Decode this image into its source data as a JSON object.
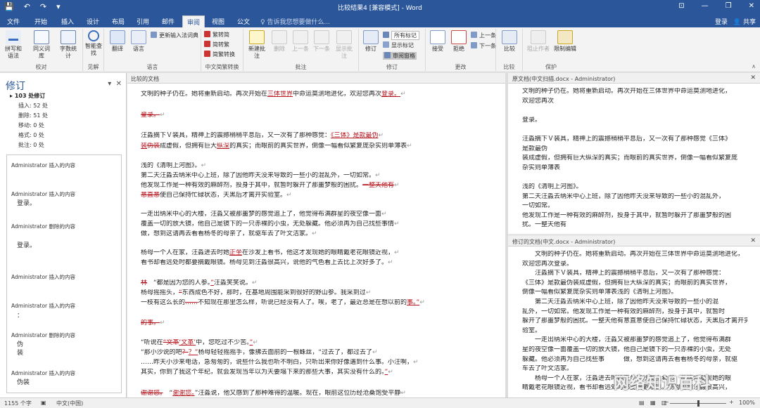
{
  "window": {
    "title": "比较结果4 [兼容模式] - Word",
    "quick_access": [
      "💾",
      "↶",
      "↷",
      "▾"
    ],
    "controls": [
      "⊡",
      "—",
      "❐",
      "✕"
    ]
  },
  "tabs": [
    "文件",
    "开始",
    "插入",
    "设计",
    "布局",
    "引用",
    "邮件",
    "审阅",
    "视图",
    "公文"
  ],
  "tell_me": "♀ 告诉我您想要做什么...",
  "login": "登录",
  "share": "共享",
  "ribbon": {
    "proof": {
      "label": "校对",
      "buttons": [
        "拼写和语法",
        "同义词库",
        "字数统计"
      ]
    },
    "insights": {
      "label": "见解",
      "buttons": [
        "智能查找"
      ]
    },
    "language": {
      "label": "语言",
      "buttons": [
        "翻译",
        "语言"
      ],
      "extra": "更新输入法词典"
    },
    "chinese": {
      "label": "中文简繁转换",
      "items": [
        "繁转简",
        "简转繁",
        "简繁转换"
      ]
    },
    "comments": {
      "label": "批注",
      "buttons": [
        "新建批注",
        "删除",
        "上一条",
        "下一条",
        "显示批注"
      ]
    },
    "tracking": {
      "label": "修订",
      "buttons": [
        "修订"
      ],
      "markup": "所有标记",
      "show_markup": "显示标记",
      "pane": "审阅窗格"
    },
    "changes": {
      "label": "更改",
      "buttons": [
        "接受",
        "拒绝"
      ],
      "prev": "上一条",
      "next": "下一条"
    },
    "compare": {
      "label": "比较",
      "buttons": [
        "比较"
      ]
    },
    "protect": {
      "label": "保护",
      "buttons": [
        "阻止作者",
        "限制编辑"
      ]
    }
  },
  "revisions_pane": {
    "title": "修订",
    "count": "103 处修订",
    "stats": [
      "插入: 52 处",
      "删除: 51 处",
      "移动: 0 处",
      "格式: 0 处",
      "批注: 0 处"
    ],
    "entries": [
      {
        "author": "Administrator",
        "action": "插入的内容",
        "text": ""
      },
      {
        "author": "Administrator",
        "action": "插入的内容",
        "text": "登录。"
      },
      {
        "author": "Administrator",
        "action": "删除的内容",
        "text": "登录。"
      },
      {
        "author": "Administrator",
        "action": "插入的内容",
        "text": ""
      },
      {
        "author": "Administrator",
        "action": "插入的内容",
        "text": "："
      },
      {
        "author": "Administrator",
        "action": "删除的内容",
        "text": "伪"
      },
      {
        "author": "",
        "action": "",
        "text": "装"
      },
      {
        "author": "Administrator",
        "action": "插入的内容",
        "text": "伪装"
      }
    ]
  },
  "compared_doc": {
    "header": "比较的文档",
    "lines": [
      [
        [
          "n",
          "文明的种子仍在。她将重新启动。再次开始在"
        ],
        [
          "i",
          "三体世界"
        ],
        [
          "n",
          "中命运莫测地进化，欢迎您再次"
        ],
        [
          "i",
          "登录。"
        ]
      ],
      [
        [
          "d",
          "登录。"
        ]
      ],
      [
        [
          "n",
          "汪淼摘下Ｖ装具，精神上的震撼稍稍平息后，又一次有了那种感觉："
        ],
        [
          "i",
          "《三体》是款最伪"
        ]
      ],
      [
        [
          "i",
          "装"
        ],
        [
          "d",
          "伪装"
        ],
        [
          "n",
          "成虚假，但拥有巨大"
        ],
        [
          "i",
          "纵深"
        ],
        [
          "n",
          "的真实"
        ],
        [
          "n",
          "；而眼前的真实世界，倒像一幅看似繁复庞杂实则单薄表"
        ]
      ],
      [
        [
          "n",
          "浅的《清明上河图》。"
        ]
      ],
      [
        [
          "n",
          "第二天汪淼去纳米中心上班，除了因他昨天没来导致的一些小的混乱外，一切如常。"
        ]
      ],
      [
        [
          "n",
          "他发现工作是一种有效的麻醉剂，投身于其中，就暂时躲开了那噩梦般的困扰。"
        ],
        [
          "d",
          "一整天他有"
        ]
      ],
      [
        [
          "d",
          "意直意"
        ],
        [
          "n",
          "使自己保持忙碌状态，天黑后才离开实验室。"
        ]
      ],
      [
        [
          "n",
          "一走出纳米中心的大楼，汪淼又被那噩梦的感觉追上了，他觉得布满群星的夜空像一面"
        ]
      ],
      [
        [
          "n",
          "覆盖一切的放大镜，他自己是镜下的一只赤裸的小虫，无处躲藏。他必须再为自己找些事情"
        ]
      ],
      [
        [
          "n",
          "做，想到这请再去看看杨冬的母亲了，就驱车去了叶文洁家。"
        ]
      ],
      [
        [
          "n",
          "杨母一个人在家，汪淼进去时她"
        ],
        [
          "i",
          "正坐"
        ],
        [
          "n",
          "在沙发上看书，他这才发现她的眼睛戴老花眼镜近视，"
        ]
      ],
      [
        [
          "n",
          "看书却看远处时都要摘戴眼镜。杨母见到汪淼很高兴，说他的气色看上去比上次好多了。"
        ]
      ],
      [
        [
          "d",
          "林"
        ],
        [
          "n",
          "　“都是因为您的人参。"
        ],
        [
          "i",
          "”"
        ],
        [
          "n",
          "汪淼笑笑说。"
        ]
      ],
      [
        [
          "n",
          "杨母摇摇头，"
        ],
        [
          "d",
          "“"
        ],
        [
          "n",
          "东西成色不好，那时，在基地周围能采到很好的野山参。我采到过"
        ]
      ],
      [
        [
          "n",
          "一枝有这么长的"
        ],
        [
          "d",
          "……"
        ],
        [
          "n",
          "不知现在那里怎么样，听说已经没有人了。唉，老了，最近总是在想以前的"
        ],
        [
          "i",
          "事。"
        ],
        [
          "i",
          "”"
        ]
      ],
      [
        [
          "d",
          "的事。"
        ]
      ],
      [
        [
          "n",
          "“听说在"
        ],
        [
          "d",
          "“文革"
        ],
        [
          "i",
          "‘文革’"
        ],
        [
          "n",
          "中，您吃过不少苦。"
        ],
        [
          "i",
          "”"
        ]
      ],
      [
        [
          "n",
          "“那小沙说的吧"
        ],
        [
          "d",
          "？"
        ],
        [
          "i",
          "？”"
        ],
        [
          "n",
          "杨母轻轻摇摇手，像拂去面前的一根蛛丝，"
        ],
        [
          "n",
          "“过去了，都过去了"
        ]
      ],
      [
        [
          "n",
          "……昨天小沙来电话，急匆匆的，说些什么我也听不明白，只听出来你好像遇到什么事。小汪啊，"
        ]
      ],
      [
        [
          "n",
          "其实，你到了我这个年纪，就会发现当年以为天要塌下来的那些大事，其实没有什么的。"
        ],
        [
          "i",
          "”"
        ]
      ],
      [
        [
          "d",
          "谢谢您。"
        ],
        [
          "n",
          "　“"
        ],
        [
          "i",
          "谢谢您。"
        ],
        [
          "n",
          "”汪淼说，他又感到了那种难得的温暖。现在，眼前这位历经沧桑饱受平静"
        ]
      ]
    ]
  },
  "original_doc": {
    "header": "原文档(中文扫描.docx - Administrator)",
    "lines": [
      "文明的种子仍在。她将重新启动。再次开始在三体世界中命运莫测地进化，",
      "欢迎您再次",
      "",
      "登录。",
      "",
      "汪淼摘下Ｖ装具，精神上的震撼稍稍平息后，又一次有了那种感觉《三体》",
      "是款最伪",
      "装成虚假，但拥有巨大纵深的真实；而眼前的真实世界，倒像一幅看似繁复庞",
      "杂实则单薄表",
      "",
      "浅的《清明上河图》。",
      "第二天汪淼去纳米中心上班，除了因他昨天没来导致的一些小的混乱外，",
      "一切如常。",
      "他发现工作是一种有效的麻醉剂，投身于其中，就暂时躲开了那噩梦般的困",
      "扰。一整天他有"
    ]
  },
  "revised_doc": {
    "header": "修订的文档(中文.docx - Administrator)",
    "lines": [
      "　　文明的种子仍在。她将重新启动。再次开始在三体世界中命运莫测地进化，",
      "欢迎您再次登录。",
      "　　汪淼摘下Ｖ装具，精神上的震撼稍稍平息后，又一次有了那种感觉：",
      "《三体》是款最伪装成虚假，但拥有巨大纵深的真实；而眼前的真实世界，",
      "倒像一幅看似繁复庞杂实则单薄表浅的《清明上河图》。",
      "　　第二天汪淼去纳米中心上班，除了因他昨天没来导致的一些小的混",
      "乱外，一切如常。他发现工作是一种有效的麻醉剂，投身于其中，就暂时",
      "躲开了那噩梦般的困扰。一整天他有意直意使自己保持忙碌状态，天黑后才离开实",
      "验室。",
      "　　一走出纳米中心的大楼，汪淼又被那噩梦的感觉追上了，他觉得布满群",
      "星的夜空像一面覆盖一切的放大镜，他自己是镜下的一只赤裸的小虫，无处",
      "躲藏。他必须再为自己找些事　　　做，想到这请再去看看杨冬的母亲，就驱",
      "车去了叶文洁家。",
      "　　杨母一个人在家，汪淼进去时她正坐在沙发上看书，他这才发现她的眼",
      "睛戴老花眼镜近视，看书却看远处时都要摘戴眼镜。杨母见到汪淼很高兴，"
    ]
  },
  "statusbar": {
    "words": "1155 个字",
    "lang": "中文(中国)",
    "zoom": "100%",
    "zoom_level": 0.5
  },
  "watermark": "网络知识百科",
  "colors": {
    "brand": "#2b579a",
    "revision": "#b5121b"
  }
}
